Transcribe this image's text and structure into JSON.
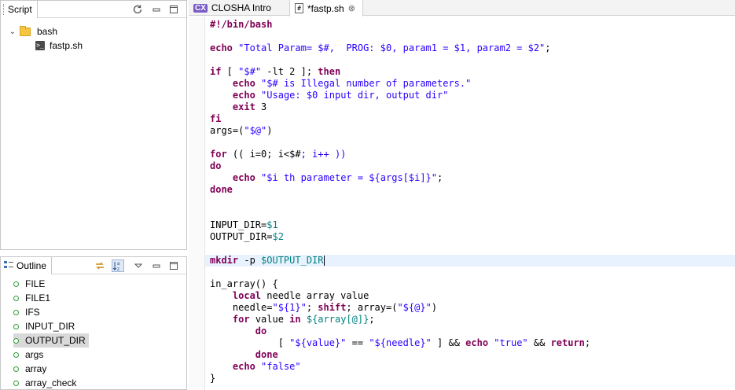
{
  "script_view": {
    "title": "Script",
    "tree": [
      {
        "label": "bash",
        "type": "folder",
        "expanded": true
      },
      {
        "label": "fastp.sh",
        "type": "file"
      }
    ]
  },
  "outline_view": {
    "title": "Outline",
    "selected": "OUTPUT_DIR",
    "items": [
      "FILE",
      "FILE1",
      "IFS",
      "INPUT_DIR",
      "OUTPUT_DIR",
      "args",
      "array",
      "array_check"
    ]
  },
  "editor": {
    "tabs": [
      {
        "label": "CLOSHA Intro",
        "active": false
      },
      {
        "label": "*fastp.sh",
        "active": true
      }
    ],
    "lines": [
      [
        {
          "t": "#!/bin/bash",
          "c": "kw"
        }
      ],
      [],
      [
        {
          "t": "echo",
          "c": "kw"
        },
        {
          "t": " ",
          "c": "plain"
        },
        {
          "t": "\"Total Param= $#,  PROG: $0, param1 = $1, param2 = $2\"",
          "c": "str"
        },
        {
          "t": ";",
          "c": "plain"
        }
      ],
      [],
      [
        {
          "t": "if",
          "c": "kw"
        },
        {
          "t": " [ ",
          "c": "plain"
        },
        {
          "t": "\"$#\"",
          "c": "str"
        },
        {
          "t": " -lt 2 ]; ",
          "c": "plain"
        },
        {
          "t": "then",
          "c": "kw"
        }
      ],
      [
        {
          "t": "    ",
          "c": "plain"
        },
        {
          "t": "echo",
          "c": "kw"
        },
        {
          "t": " ",
          "c": "plain"
        },
        {
          "t": "\"$# is Illegal number of parameters.\"",
          "c": "str"
        }
      ],
      [
        {
          "t": "    ",
          "c": "plain"
        },
        {
          "t": "echo",
          "c": "kw"
        },
        {
          "t": " ",
          "c": "plain"
        },
        {
          "t": "\"Usage: $0 input dir, output dir\"",
          "c": "str"
        }
      ],
      [
        {
          "t": "    ",
          "c": "plain"
        },
        {
          "t": "exit",
          "c": "kw"
        },
        {
          "t": " 3",
          "c": "plain"
        }
      ],
      [
        {
          "t": "fi",
          "c": "kw"
        }
      ],
      [
        {
          "t": "args=(",
          "c": "plain"
        },
        {
          "t": "\"$@\"",
          "c": "str"
        },
        {
          "t": ")",
          "c": "plain"
        }
      ],
      [],
      [
        {
          "t": "for",
          "c": "kw"
        },
        {
          "t": " (( i=0; i<$#",
          "c": "plain"
        },
        {
          "t": "; i++ ))",
          "c": "str"
        }
      ],
      [
        {
          "t": "do",
          "c": "kw"
        }
      ],
      [
        {
          "t": "    ",
          "c": "plain"
        },
        {
          "t": "echo",
          "c": "kw"
        },
        {
          "t": " ",
          "c": "plain"
        },
        {
          "t": "\"$i th parameter = ${args[$i]}\"",
          "c": "str"
        },
        {
          "t": ";",
          "c": "plain"
        }
      ],
      [
        {
          "t": "done",
          "c": "kw"
        }
      ],
      [],
      [],
      [
        {
          "t": "INPUT_DIR=",
          "c": "plain"
        },
        {
          "t": "$1",
          "c": "var"
        }
      ],
      [
        {
          "t": "OUTPUT_DIR=",
          "c": "plain"
        },
        {
          "t": "$2",
          "c": "var"
        }
      ],
      [],
      [
        {
          "t": "mkdir",
          "c": "kw"
        },
        {
          "t": " -p ",
          "c": "plain"
        },
        {
          "t": "$OUTPUT_DIR",
          "c": "var"
        }
      ],
      [],
      [
        {
          "t": "in_array() {",
          "c": "plain"
        }
      ],
      [
        {
          "t": "    ",
          "c": "plain"
        },
        {
          "t": "local",
          "c": "kw"
        },
        {
          "t": " needle array value",
          "c": "plain"
        }
      ],
      [
        {
          "t": "    needle=",
          "c": "plain"
        },
        {
          "t": "\"${1}\"",
          "c": "str"
        },
        {
          "t": "; ",
          "c": "plain"
        },
        {
          "t": "shift",
          "c": "kw"
        },
        {
          "t": "; array=(",
          "c": "plain"
        },
        {
          "t": "\"${@}\"",
          "c": "str"
        },
        {
          "t": ")",
          "c": "plain"
        }
      ],
      [
        {
          "t": "    ",
          "c": "plain"
        },
        {
          "t": "for",
          "c": "kw"
        },
        {
          "t": " value ",
          "c": "plain"
        },
        {
          "t": "in",
          "c": "kw"
        },
        {
          "t": " ",
          "c": "plain"
        },
        {
          "t": "${array[@]}",
          "c": "var"
        },
        {
          "t": ";",
          "c": "plain"
        }
      ],
      [
        {
          "t": "        ",
          "c": "plain"
        },
        {
          "t": "do",
          "c": "kw"
        }
      ],
      [
        {
          "t": "            [ ",
          "c": "plain"
        },
        {
          "t": "\"${value}\"",
          "c": "str"
        },
        {
          "t": " == ",
          "c": "plain"
        },
        {
          "t": "\"${needle}\"",
          "c": "str"
        },
        {
          "t": " ] && ",
          "c": "plain"
        },
        {
          "t": "echo",
          "c": "kw"
        },
        {
          "t": " ",
          "c": "plain"
        },
        {
          "t": "\"true\"",
          "c": "str"
        },
        {
          "t": " && ",
          "c": "plain"
        },
        {
          "t": "return",
          "c": "kw"
        },
        {
          "t": ";",
          "c": "plain"
        }
      ],
      [
        {
          "t": "        ",
          "c": "plain"
        },
        {
          "t": "done",
          "c": "kw"
        }
      ],
      [
        {
          "t": "    ",
          "c": "plain"
        },
        {
          "t": "echo",
          "c": "kw"
        },
        {
          "t": " ",
          "c": "plain"
        },
        {
          "t": "\"false\"",
          "c": "str"
        }
      ],
      [
        {
          "t": "}",
          "c": "plain"
        }
      ]
    ],
    "current_line": 20
  },
  "icons": {
    "refresh": "refresh-icon",
    "minimize": "minimize-icon",
    "maximize": "maximize-icon",
    "sync": "link-with-editor-icon",
    "sort": "sort-az-icon",
    "view_menu": "view-menu-icon"
  },
  "colors": {
    "keyword": "#7f0055",
    "string": "#2a00ff",
    "variable": "#008080",
    "current_line": "#e8f2fe",
    "outline_dot": "#2f9c3a"
  }
}
